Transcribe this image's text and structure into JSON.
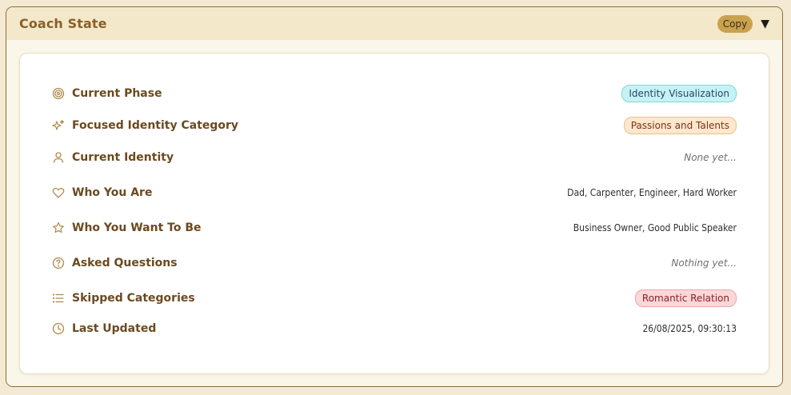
{
  "panel": {
    "title": "Coach State",
    "copy_label": "Copy",
    "toggle_glyph": "▼"
  },
  "fields": {
    "current_phase": {
      "label": "Current Phase",
      "value": "Identity Visualization",
      "icon": "target-icon"
    },
    "focused_category": {
      "label": "Focused Identity Category",
      "value": "Passions and Talents",
      "icon": "sparkles-icon"
    },
    "current_identity": {
      "label": "Current Identity",
      "value": "None yet...",
      "icon": "user-icon"
    },
    "who_you_are": {
      "label": "Who You Are",
      "value": "Dad, Carpenter, Engineer, Hard Worker",
      "icon": "heart-icon"
    },
    "who_you_want_to_be": {
      "label": "Who You Want To Be",
      "value": "Business Owner, Good Public Speaker",
      "icon": "star-icon"
    },
    "asked_questions": {
      "label": "Asked Questions",
      "value": "Nothing yet...",
      "icon": "question-circle-icon"
    },
    "skipped_categories": {
      "label": "Skipped Categories",
      "value": "Romantic Relation",
      "icon": "list-icon"
    },
    "last_updated": {
      "label": "Last Updated",
      "value": "26/08/2025, 09:30:13",
      "icon": "clock-icon"
    }
  },
  "colors": {
    "accent": "#c9a24e",
    "label": "#6b4a1f",
    "phase_badge": "#c6f2f6",
    "category_badge": "#fde7cf",
    "skipped_badge": "#fbd8d8"
  }
}
